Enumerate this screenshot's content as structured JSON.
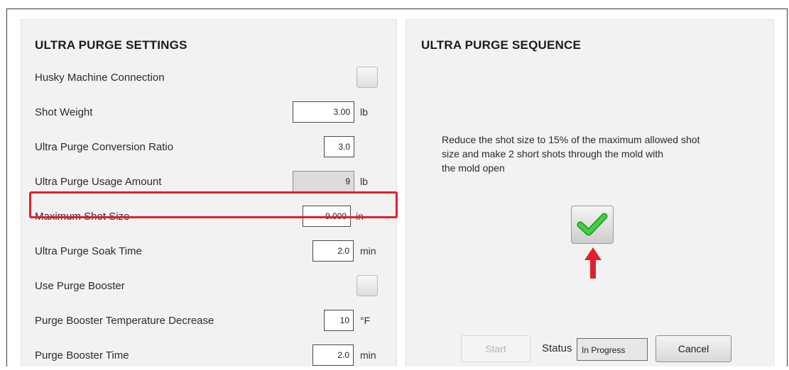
{
  "settings": {
    "title": "ULTRA PURGE SETTINGS",
    "rows": [
      {
        "label": "Husky Machine Connection"
      },
      {
        "label": "Shot Weight",
        "value": "3.00",
        "unit": "lb"
      },
      {
        "label": "Ultra Purge Conversion Ratio",
        "value": "3.0"
      },
      {
        "label": "Ultra Purge Usage Amount",
        "value": "9",
        "unit": "lb"
      },
      {
        "label": "Maximum Shot Size",
        "value": "9.000",
        "unit": "in"
      },
      {
        "label": "Ultra Purge Soak Time",
        "value": "2.0",
        "unit": "min"
      },
      {
        "label": "Use Purge Booster"
      },
      {
        "label": "Purge Booster Temperature Decrease",
        "value": "10",
        "unit": "°F"
      },
      {
        "label": "Purge Booster Time",
        "value": "2.0",
        "unit": "min"
      }
    ]
  },
  "sequence": {
    "title": "ULTRA PURGE SEQUENCE",
    "instruction_lines": [
      "Reduce the shot size to 15% of the maximum allowed shot",
      "size and make 2 short shots through the mold with",
      "the mold open"
    ],
    "confirm_icon": "green-checkmark-icon",
    "start_label": "Start",
    "status_label": "Status",
    "status_value": "In Progress",
    "cancel_label": "Cancel"
  },
  "colors": {
    "highlight": "#e0202c",
    "arrow": "#e0202c",
    "check": "#2fb52f"
  }
}
